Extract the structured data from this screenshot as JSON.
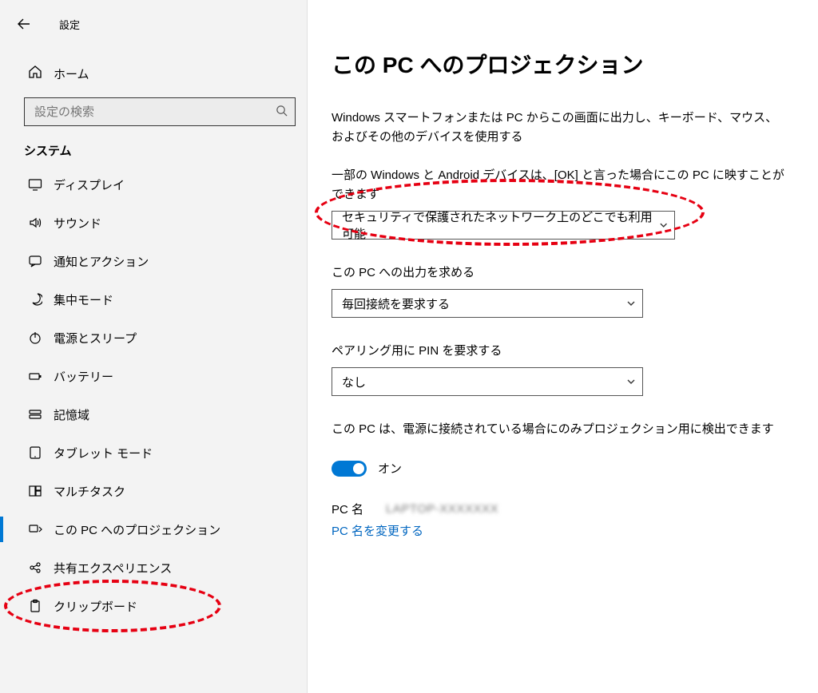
{
  "window": {
    "title": "設定"
  },
  "sidebar": {
    "home": "ホーム",
    "search_placeholder": "設定の検索",
    "category": "システム",
    "items": [
      {
        "icon": "display-icon",
        "label": "ディスプレイ"
      },
      {
        "icon": "sound-icon",
        "label": "サウンド"
      },
      {
        "icon": "notify-icon",
        "label": "通知とアクション"
      },
      {
        "icon": "focus-icon",
        "label": "集中モード"
      },
      {
        "icon": "power-icon",
        "label": "電源とスリープ"
      },
      {
        "icon": "battery-icon",
        "label": "バッテリー"
      },
      {
        "icon": "storage-icon",
        "label": "記憶域"
      },
      {
        "icon": "tablet-icon",
        "label": "タブレット モード"
      },
      {
        "icon": "multitask-icon",
        "label": "マルチタスク"
      },
      {
        "icon": "project-icon",
        "label": "この PC へのプロジェクション"
      },
      {
        "icon": "share-icon",
        "label": "共有エクスペリエンス"
      },
      {
        "icon": "clipboard-icon",
        "label": "クリップボード"
      }
    ],
    "selected_index": 9
  },
  "main": {
    "heading": "この PC へのプロジェクション",
    "intro": "Windows スマートフォンまたは PC からこの画面に出力し、キーボード、マウス、およびその他のデバイスを使用する",
    "s1": {
      "label": "一部の Windows と Android デバイスは、[OK] と言った場合にこの PC に映すことができます",
      "value": "セキュリティで保護されたネットワーク上のどこでも利用可能"
    },
    "s2": {
      "label": "この PC への出力を求める",
      "value": "毎回接続を要求する"
    },
    "s3": {
      "label": "ペアリング用に PIN を要求する",
      "value": "なし"
    },
    "s4": {
      "label": "この PC は、電源に接続されている場合にのみプロジェクション用に検出できます",
      "toggle_label": "オン"
    },
    "pc_name_label": "PC 名",
    "pc_name_value": "LAPTOP-XXXXXXX",
    "rename_link": "PC 名を変更する"
  }
}
